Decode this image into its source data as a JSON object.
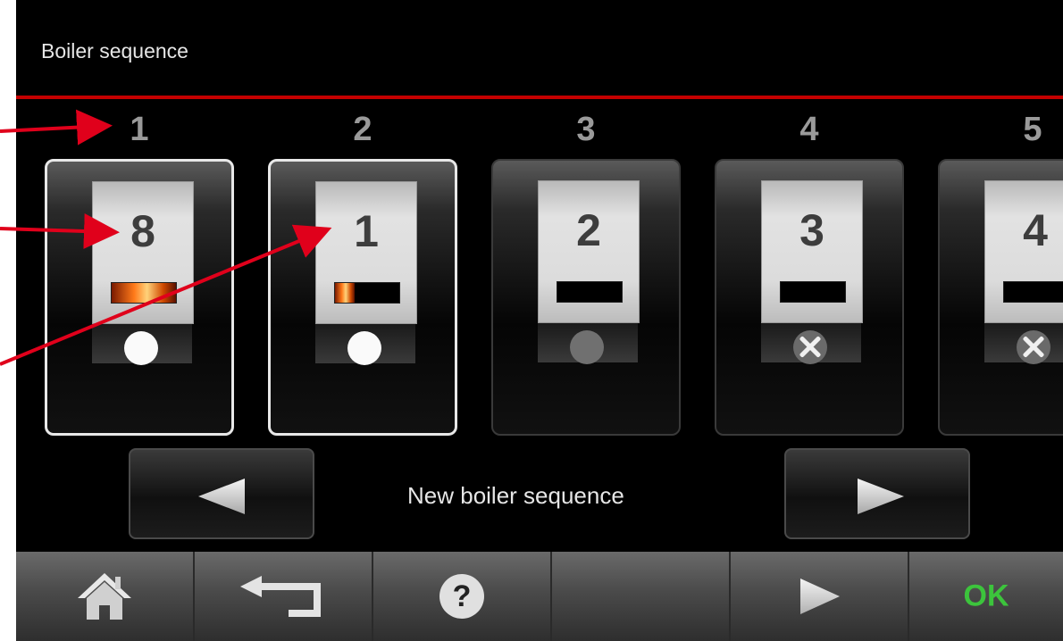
{
  "title": "Boiler sequence",
  "slots": [
    {
      "position": "1",
      "boiler": "8",
      "flame_level": 1.0,
      "status": "white-dot",
      "selected": true
    },
    {
      "position": "2",
      "boiler": "1",
      "flame_level": 0.3,
      "status": "white-dot",
      "selected": true
    },
    {
      "position": "3",
      "boiler": "2",
      "flame_level": 0,
      "status": "grey-dot",
      "selected": false
    },
    {
      "position": "4",
      "boiler": "3",
      "flame_level": 0,
      "status": "x-mark",
      "selected": false
    },
    {
      "position": "5",
      "boiler": "4",
      "flame_level": 0,
      "status": "x-mark",
      "selected": false
    }
  ],
  "sequence_nav": {
    "label": "New boiler sequence",
    "prev_icon": "left-triangle-icon",
    "next_icon": "right-triangle-icon"
  },
  "bottom_bar": {
    "items": [
      {
        "icon": "home-icon"
      },
      {
        "icon": "back-arrow-icon"
      },
      {
        "icon": "help-icon"
      },
      {
        "icon": ""
      },
      {
        "icon": "forward-arrow-icon"
      },
      {
        "label": "OK"
      }
    ]
  },
  "colors": {
    "accent_rule": "#c40000",
    "annotation_arrow": "#e0001b",
    "ok_text": "#3cc43c"
  }
}
